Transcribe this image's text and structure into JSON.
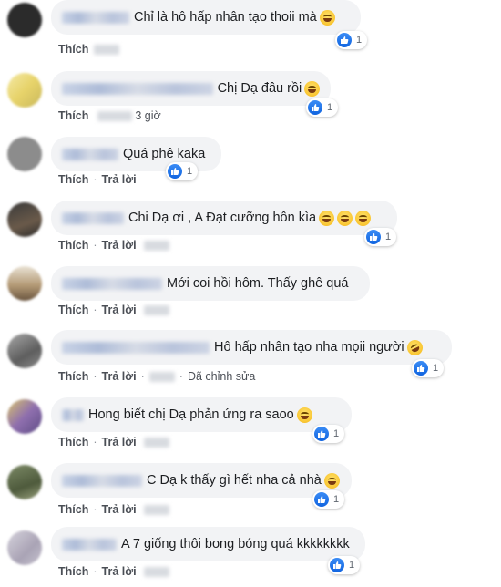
{
  "colors": {
    "bubble_bg": "#f2f3f5",
    "like_blue": "#1877f2",
    "text": "#1c1e21",
    "meta_text": "#4b4f56"
  },
  "comments": [
    {
      "text": "Chỉ là hô hấp nhân tạo thoii mà",
      "emoji": "grinning-face-icon",
      "like_count": "1",
      "actions": [
        "Thích"
      ]
    },
    {
      "text": "Chị Dạ đâu rồi",
      "emoji": "laughing-face-icon",
      "like_count": "1",
      "actions": [
        "Thích"
      ],
      "time_suffix": "3 giờ"
    },
    {
      "text": "Quá phê kaka",
      "like_count": "1",
      "actions": [
        "Thích",
        "Trả lời"
      ]
    },
    {
      "text": "Chi Dạ ơi , A Đạt cưỡng hôn kìa",
      "emoji": "grinning-face-icon",
      "like_count": "1",
      "actions": [
        "Thích",
        "Trả lời"
      ]
    },
    {
      "text": "Mới coi hồi hôm. Thấy ghê quá",
      "actions": [
        "Thích",
        "Trả lời"
      ]
    },
    {
      "text": "Hô hấp nhân tạo nha mọii người",
      "emoji": "rolling-laughing-face-icon",
      "like_count": "1",
      "actions": [
        "Thích",
        "Trả lời"
      ],
      "edited": "Đã chỉnh sửa"
    },
    {
      "text": "Hong biết chị Dạ phản ứng ra saoo",
      "emoji": "dizzy-face-icon",
      "like_count": "1",
      "actions": [
        "Thích",
        "Trả lời"
      ]
    },
    {
      "text": "C Dạ k thấy gì hết nha cả nhà",
      "emoji": "laughing-face-icon",
      "like_count": "1",
      "actions": [
        "Thích",
        "Trả lời"
      ]
    },
    {
      "text": "A 7 giống thôi bong bóng quá kkkkkkkk",
      "like_count": "1",
      "actions": [
        "Thích",
        "Trả lời"
      ]
    }
  ]
}
